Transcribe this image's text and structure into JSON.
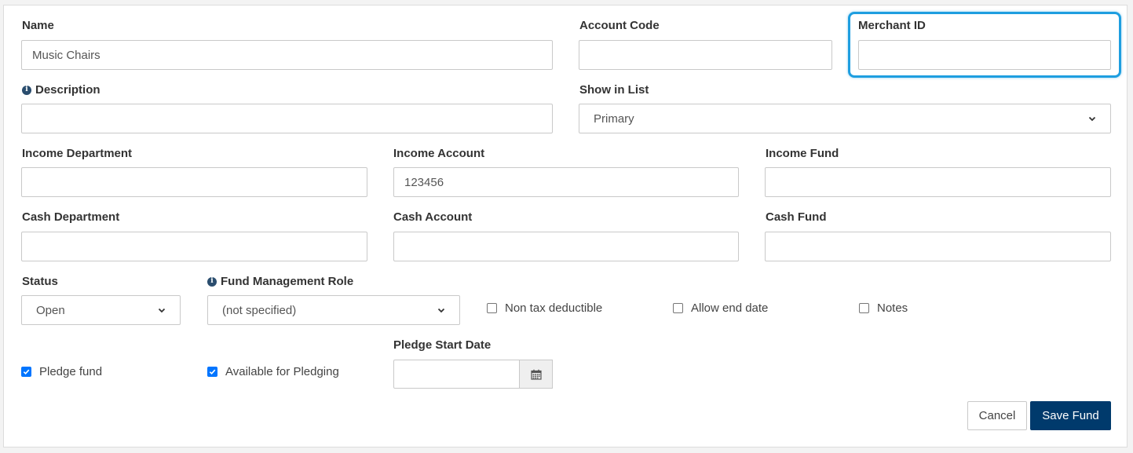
{
  "fields": {
    "name": {
      "label": "Name",
      "value": "Music Chairs"
    },
    "account_code": {
      "label": "Account Code",
      "value": ""
    },
    "merchant_id": {
      "label": "Merchant ID",
      "value": ""
    },
    "description": {
      "label": "Description",
      "value": ""
    },
    "show_in_list": {
      "label": "Show in List",
      "value": "Primary"
    },
    "income_department": {
      "label": "Income Department",
      "value": ""
    },
    "income_account": {
      "label": "Income Account",
      "value": "123456"
    },
    "income_fund": {
      "label": "Income Fund",
      "value": ""
    },
    "cash_department": {
      "label": "Cash Department",
      "value": ""
    },
    "cash_account": {
      "label": "Cash Account",
      "value": ""
    },
    "cash_fund": {
      "label": "Cash Fund",
      "value": ""
    },
    "status": {
      "label": "Status",
      "value": "Open"
    },
    "fund_management_role": {
      "label": "Fund Management Role",
      "value": "(not specified)"
    },
    "pledge_start_date": {
      "label": "Pledge Start Date",
      "value": ""
    }
  },
  "checkboxes": {
    "non_tax_deductible": {
      "label": "Non tax deductible",
      "checked": false
    },
    "allow_end_date": {
      "label": "Allow end date",
      "checked": false
    },
    "notes": {
      "label": "Notes",
      "checked": false
    },
    "pledge_fund": {
      "label": "Pledge fund",
      "checked": true
    },
    "available_for_pledging": {
      "label": "Available for Pledging",
      "checked": true
    }
  },
  "buttons": {
    "cancel": "Cancel",
    "save": "Save Fund"
  },
  "icons": {
    "info": "info-circle-icon",
    "calendar": "calendar-icon",
    "chevron": "chevron-down-icon",
    "check": "checkmark-icon"
  },
  "colors": {
    "highlight": "#1e9ee0",
    "primary_button": "#003a6c",
    "checkbox_checked": "#0075ff"
  }
}
